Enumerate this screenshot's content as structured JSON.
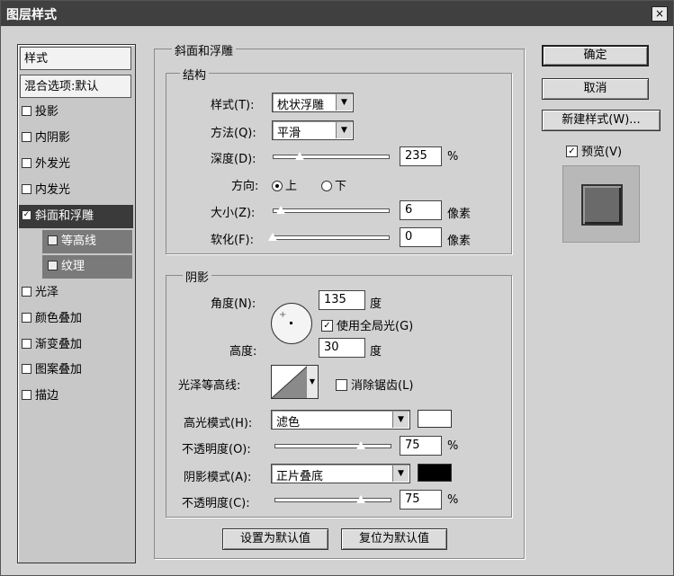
{
  "window": {
    "title": "图层样式",
    "close": "×"
  },
  "style_list": {
    "header": "样式",
    "blend_options": "混合选项:默认",
    "items": [
      {
        "label": "投影",
        "checked": false
      },
      {
        "label": "内阴影",
        "checked": false
      },
      {
        "label": "外发光",
        "checked": false
      },
      {
        "label": "内发光",
        "checked": false
      },
      {
        "label": "斜面和浮雕",
        "checked": true
      },
      {
        "label": "等高线",
        "checked": false
      },
      {
        "label": "纹理",
        "checked": false
      },
      {
        "label": "光泽",
        "checked": false
      },
      {
        "label": "颜色叠加",
        "checked": false
      },
      {
        "label": "渐变叠加",
        "checked": false
      },
      {
        "label": "图案叠加",
        "checked": false
      },
      {
        "label": "描边",
        "checked": false
      }
    ]
  },
  "bevel": {
    "title": "斜面和浮雕",
    "structure": {
      "title": "结构",
      "style_label": "样式(T):",
      "style_value": "枕状浮雕",
      "technique_label": "方法(Q):",
      "technique_value": "平滑",
      "depth_label": "深度(D):",
      "depth_value": "235",
      "depth_unit": "%",
      "depth_fraction": 0.235,
      "direction_label": "方向:",
      "dir_up": "上",
      "dir_down": "下",
      "direction_selected": "上",
      "size_label": "大小(Z):",
      "size_value": "6",
      "size_unit": "像素",
      "soften_label": "软化(F):",
      "soften_value": "0",
      "soften_unit": "像素"
    },
    "shading": {
      "title": "阴影",
      "angle_label": "角度(N):",
      "angle_value": "135",
      "angle_unit": "度",
      "global_light_label": "使用全局光(G)",
      "global_light_checked": true,
      "altitude_label": "高度:",
      "altitude_value": "30",
      "altitude_unit": "度",
      "gloss_label": "光泽等高线:",
      "antialias_label": "消除锯齿(L)",
      "antialias_checked": false,
      "highlight_mode_label": "高光模式(H):",
      "highlight_mode_value": "滤色",
      "highlight_color": "#ffffff",
      "highlight_opacity_label": "不透明度(O):",
      "highlight_opacity_value": "75",
      "highlight_opacity_unit": "%",
      "highlight_opacity_fraction": 0.75,
      "shadow_mode_label": "阴影模式(A):",
      "shadow_mode_value": "正片叠底",
      "shadow_color": "#000000",
      "shadow_opacity_label": "不透明度(C):",
      "shadow_opacity_value": "75",
      "shadow_opacity_unit": "%",
      "shadow_opacity_fraction": 0.75
    },
    "make_default": "设置为默认值",
    "reset_default": "复位为默认值"
  },
  "buttons": {
    "ok": "确定",
    "cancel": "取消",
    "new_style": "新建样式(W)...",
    "preview_label": "预览(V)",
    "preview_checked": true
  }
}
